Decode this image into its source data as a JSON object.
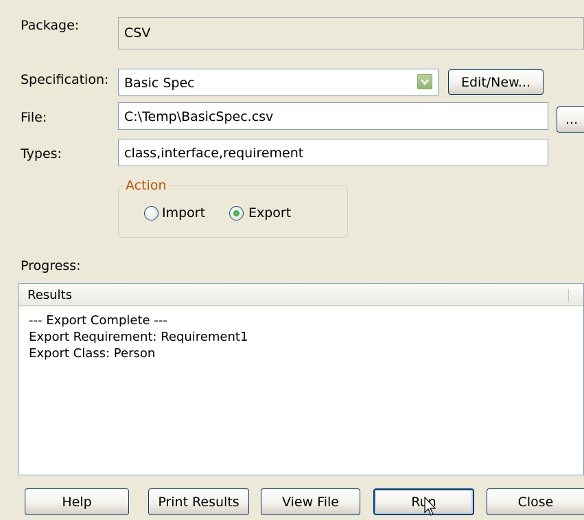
{
  "labels": {
    "package": "Package:",
    "specification": "Specification:",
    "file": "File:",
    "types": "Types:",
    "progress": "Progress:"
  },
  "fields": {
    "package_value": "CSV",
    "specification_value": "Basic Spec",
    "file_value": "C:\\Temp\\BasicSpec.csv",
    "types_value": "class,interface,requirement"
  },
  "buttons": {
    "edit_new": "Edit/New...",
    "browse": "...",
    "help": "Help",
    "print_results": "Print Results",
    "view_file": "View File",
    "run": "Run",
    "close": "Close"
  },
  "action": {
    "title": "Action",
    "options": [
      "Import",
      "Export"
    ],
    "selected": "Export"
  },
  "results": {
    "column_header": "Results",
    "lines": [
      "--- Export Complete ---",
      "Export Requirement: Requirement1",
      "Export Class: Person"
    ]
  },
  "icons": {
    "combo_arrow": "chevron-down-icon",
    "cursor": "mouse-pointer-icon"
  },
  "colors": {
    "dialog_bg": "#ece9d8",
    "group_title": "#c0530f",
    "combo_arrow": "#8fb86e",
    "border": "#7f9db9"
  }
}
